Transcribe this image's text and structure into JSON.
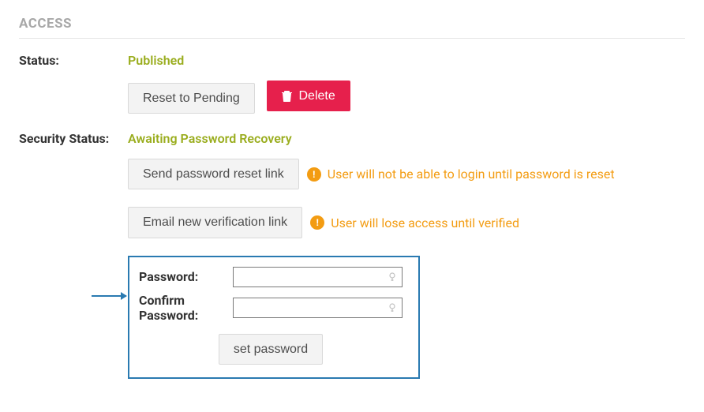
{
  "section": {
    "title": "ACCESS"
  },
  "status": {
    "label": "Status:",
    "value": "Published",
    "reset_btn": "Reset to Pending",
    "delete_btn": "Delete"
  },
  "security": {
    "label": "Security Status:",
    "value": "Awaiting Password Recovery",
    "send_reset_btn": "Send password reset link",
    "send_reset_warn": "User will not be able to login until password is reset",
    "email_verify_btn": "Email new verification link",
    "email_verify_warn": "User will lose access until verified",
    "password_label": "Password:",
    "confirm_label": "Confirm Password:",
    "set_password_btn": "set password",
    "warn_glyph": "!"
  }
}
